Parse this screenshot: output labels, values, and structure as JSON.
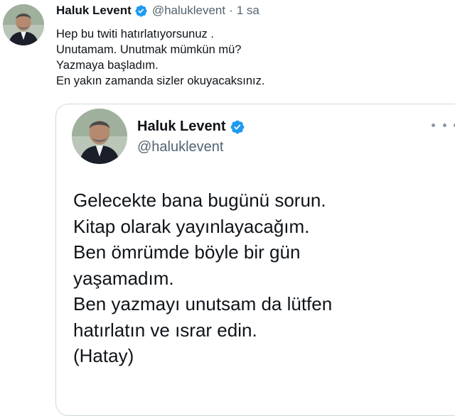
{
  "tweet": {
    "author": {
      "display_name": "Haluk Levent",
      "handle": "@haluklevent",
      "verified": true
    },
    "separator": "·",
    "timestamp": "1 sa",
    "text_lines": [
      "Hep bu twiti hatırlatıyorsunuz .",
      "Unutamam. Unutmak mümkün mü?",
      "Yazmaya başladım.",
      "En yakın zamanda sizler okuyacaksınız."
    ]
  },
  "quoted_tweet": {
    "author": {
      "display_name": "Haluk Levent",
      "handle": "@haluklevent",
      "verified": true
    },
    "text_lines": [
      "Gelecekte bana bugünü sorun.",
      "Kitap olarak yayınlayacağım.",
      "Ben ömrümde böyle bir gün",
      "yaşamadım.",
      "Ben yazmayı unutsam da lütfen",
      "hatırlatın ve ısrar edin.",
      "(Hatay)"
    ]
  },
  "icons": {
    "verified": "verified-badge-icon",
    "more": "more-horizontal-icon"
  },
  "colors": {
    "verified_blue": "#1d9bf0",
    "text_primary": "#0f1419",
    "text_secondary": "#536471",
    "border": "#cfd9de"
  }
}
